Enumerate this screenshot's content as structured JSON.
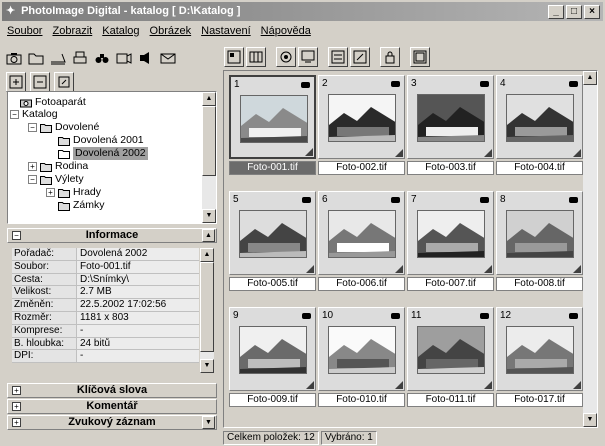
{
  "window": {
    "title": "PhotoImage Digital - katalog [ D:\\Katalog ]",
    "controls": [
      "minimize",
      "maximize",
      "close"
    ]
  },
  "menu": [
    "Soubor",
    "Zobrazit",
    "Katalog",
    "Obrázek",
    "Nastavení",
    "Nápověda"
  ],
  "tree": {
    "items": [
      {
        "label": "Fotoaparát",
        "icon": "camera-icon",
        "level": 1
      },
      {
        "label": "Katalog",
        "icon": "none",
        "level": 0,
        "expander": "−"
      },
      {
        "label": "Dovolené",
        "icon": "folder-icon",
        "level": 1,
        "expander": "−"
      },
      {
        "label": "Dovolená 2001",
        "icon": "folder-icon",
        "level": 2
      },
      {
        "label": "Dovolená 2002",
        "icon": "folder-open-icon",
        "level": 2,
        "selected": true
      },
      {
        "label": "Rodina",
        "icon": "folder-icon",
        "level": 1,
        "expander": "+"
      },
      {
        "label": "Výlety",
        "icon": "folder-icon",
        "level": 1,
        "expander": "−"
      },
      {
        "label": "Hrady",
        "icon": "folder-icon",
        "level": 2,
        "expander": "+"
      },
      {
        "label": "Zámky",
        "icon": "folder-icon",
        "level": 2
      }
    ]
  },
  "info": {
    "header": "Informace",
    "rows": [
      {
        "k": "Pořadač:",
        "v": "Dovolená 2002"
      },
      {
        "k": "Soubor:",
        "v": "Foto-001.tif"
      },
      {
        "k": "Cesta:",
        "v": "D:\\Snímky\\"
      },
      {
        "k": "Velikost:",
        "v": "2.7 MB"
      },
      {
        "k": "Změněn:",
        "v": "22.5.2002 17:02:56"
      },
      {
        "k": "Rozměr:",
        "v": "1181 x 803"
      },
      {
        "k": "Komprese:",
        "v": "-"
      },
      {
        "k": "B. hloubka:",
        "v": "24 bitů"
      },
      {
        "k": "DPI:",
        "v": "-"
      }
    ]
  },
  "panels": {
    "keywords": "Klíčová slova",
    "comment": "Komentář",
    "sound": "Zvukový záznam"
  },
  "thumbnails": [
    {
      "num": "1",
      "caption": "Foto-001.tif",
      "selected": true,
      "scene": "ship"
    },
    {
      "num": "2",
      "caption": "Foto-002.tif",
      "scene": "mountains"
    },
    {
      "num": "3",
      "caption": "Foto-003.tif",
      "scene": "waterfall"
    },
    {
      "num": "4",
      "caption": "Foto-004.tif",
      "scene": "rocks"
    },
    {
      "num": "5",
      "caption": "Foto-005.tif",
      "scene": "group"
    },
    {
      "num": "6",
      "caption": "Foto-006.tif",
      "scene": "building"
    },
    {
      "num": "7",
      "caption": "Foto-007.tif",
      "scene": "cabin"
    },
    {
      "num": "8",
      "caption": "Foto-008.tif",
      "scene": "hills"
    },
    {
      "num": "9",
      "caption": "Foto-009.tif",
      "scene": "ferry"
    },
    {
      "num": "10",
      "caption": "Foto-010.tif",
      "scene": "church"
    },
    {
      "num": "11",
      "caption": "Foto-011.tif",
      "scene": "lake"
    },
    {
      "num": "12",
      "caption": "Foto-017.tif",
      "scene": "valley"
    }
  ],
  "status": {
    "total": "Celkem položek: 12",
    "selected": "Vybráno: 1"
  }
}
